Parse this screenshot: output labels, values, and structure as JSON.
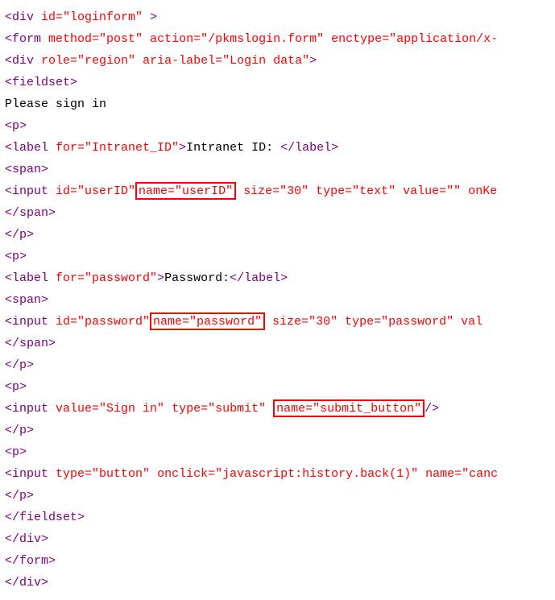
{
  "lines": [
    [
      {
        "cls": "tag",
        "t": "<div "
      },
      {
        "cls": "attr",
        "t": "id=\"loginform\""
      },
      {
        "cls": "tag",
        "t": " >"
      }
    ],
    [
      {
        "cls": "tag",
        "t": "<form "
      },
      {
        "cls": "attr",
        "t": "method=\"post\""
      },
      {
        "cls": "tag",
        "t": " "
      },
      {
        "cls": "attr",
        "t": "action=\"/pkmslogin.form\""
      },
      {
        "cls": "tag",
        "t": " "
      },
      {
        "cls": "attr",
        "t": "enctype=\"application/x-"
      }
    ],
    [
      {
        "cls": "tag",
        "t": "<div "
      },
      {
        "cls": "attr",
        "t": "role=\"region\""
      },
      {
        "cls": "tag",
        "t": " "
      },
      {
        "cls": "attr",
        "t": "aria-label=\"Login data\""
      },
      {
        "cls": "tag",
        "t": ">"
      }
    ],
    [
      {
        "cls": "tag",
        "t": "<fieldset>"
      }
    ],
    [
      {
        "cls": "txt",
        "t": "Please sign in"
      }
    ],
    [
      {
        "cls": "tag",
        "t": "<p>"
      }
    ],
    [
      {
        "cls": "tag",
        "t": "<label "
      },
      {
        "cls": "attr",
        "t": "for=\"Intranet_ID\""
      },
      {
        "cls": "tag",
        "t": ">"
      },
      {
        "cls": "txt",
        "t": "Intranet ID: "
      },
      {
        "cls": "tag",
        "t": "</label>"
      }
    ],
    [
      {
        "cls": "tag",
        "t": "<span>"
      }
    ],
    [
      {
        "cls": "tag",
        "t": "<input "
      },
      {
        "cls": "attr",
        "t": "id=\"userID\""
      },
      {
        "box": true,
        "cls": "attr",
        "t": "name=\"userID\""
      },
      {
        "cls": "tag",
        "t": " "
      },
      {
        "cls": "attr",
        "t": "size=\"30\""
      },
      {
        "cls": "tag",
        "t": " "
      },
      {
        "cls": "attr",
        "t": "type=\"text\""
      },
      {
        "cls": "tag",
        "t": " "
      },
      {
        "cls": "attr",
        "t": "value=\"\""
      },
      {
        "cls": "tag",
        "t": " "
      },
      {
        "cls": "attr",
        "t": "onKe"
      }
    ],
    [
      {
        "cls": "tag",
        "t": "</span>"
      }
    ],
    [
      {
        "cls": "tag",
        "t": "</p>"
      }
    ],
    [
      {
        "cls": "tag",
        "t": "<p>"
      }
    ],
    [
      {
        "cls": "tag",
        "t": "<label "
      },
      {
        "cls": "attr",
        "t": "for=\"password\""
      },
      {
        "cls": "tag",
        "t": ">"
      },
      {
        "cls": "txt",
        "t": "Password:"
      },
      {
        "cls": "tag",
        "t": "</label>"
      }
    ],
    [
      {
        "cls": "tag",
        "t": "<span>"
      }
    ],
    [
      {
        "cls": "tag",
        "t": "<input "
      },
      {
        "cls": "attr",
        "t": "id=\"password\""
      },
      {
        "box": true,
        "cls": "attr",
        "t": "name=\"password\""
      },
      {
        "cls": "tag",
        "t": "  "
      },
      {
        "cls": "attr",
        "t": "size=\"30\""
      },
      {
        "cls": "tag",
        "t": "  "
      },
      {
        "cls": "attr",
        "t": "type=\"password\""
      },
      {
        "cls": "tag",
        "t": " "
      },
      {
        "cls": "attr",
        "t": "val"
      }
    ],
    [
      {
        "cls": "tag",
        "t": "</span>"
      }
    ],
    [
      {
        "cls": "tag",
        "t": "</p>"
      }
    ],
    [
      {
        "cls": "tag",
        "t": "<p>"
      }
    ],
    [
      {
        "cls": "tag",
        "t": "<input "
      },
      {
        "cls": "attr",
        "t": "value=\"Sign in\""
      },
      {
        "cls": "tag",
        "t": " "
      },
      {
        "cls": "attr",
        "t": "type=\"submit\""
      },
      {
        "cls": "tag",
        "t": " "
      },
      {
        "box": true,
        "cls": "attr",
        "t": "name=\"submit_button\""
      },
      {
        "cls": "tag",
        "t": "/>"
      }
    ],
    [
      {
        "cls": "tag",
        "t": "</p>"
      }
    ],
    [
      {
        "cls": "tag",
        "t": "<p>"
      }
    ],
    [
      {
        "cls": "tag",
        "t": "<input "
      },
      {
        "cls": "attr",
        "t": "type=\"button\""
      },
      {
        "cls": "tag",
        "t": " "
      },
      {
        "cls": "attr",
        "t": "onclick=\"javascript:history.back(1)\""
      },
      {
        "cls": "tag",
        "t": " "
      },
      {
        "cls": "attr",
        "t": "name=\"canc"
      }
    ],
    [
      {
        "cls": "tag",
        "t": "</p>"
      }
    ],
    [
      {
        "cls": "tag",
        "t": "</fieldset>"
      }
    ],
    [
      {
        "cls": "tag",
        "t": "</div>"
      }
    ],
    [
      {
        "cls": "tag",
        "t": "</form>"
      }
    ],
    [
      {
        "cls": "tag",
        "t": "</div>"
      }
    ]
  ]
}
